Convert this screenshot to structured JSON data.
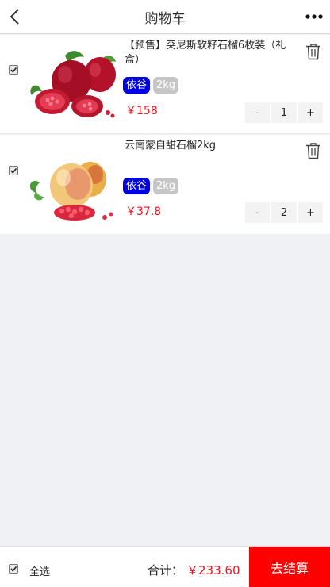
{
  "header": {
    "title": "购物车",
    "back_icon": "chevron-left-icon",
    "more_icon": "more-dots-icon"
  },
  "items": [
    {
      "name": "【预售】突尼斯软籽石榴6枚装（礼盒）",
      "brand": "依谷",
      "spec": "2kg",
      "price": "￥158",
      "qty": "1",
      "minus": "-",
      "plus": "+",
      "checked": true
    },
    {
      "name": "云南蒙自甜石榴2kg",
      "brand": "依谷",
      "spec": "2kg",
      "price": "￥37.8",
      "qty": "2",
      "minus": "-",
      "plus": "+",
      "checked": true
    }
  ],
  "footer": {
    "select_all": "全选",
    "total_label": "合计：",
    "total_value": "￥233.60",
    "checkout": "去结算",
    "checked": true
  },
  "colors": {
    "price": "#f0141e",
    "checkout_bg": "#ff0000",
    "brand_tag": "#0000e6",
    "spec_tag": "#c6c6c6",
    "page_bg": "#eff1f5"
  }
}
